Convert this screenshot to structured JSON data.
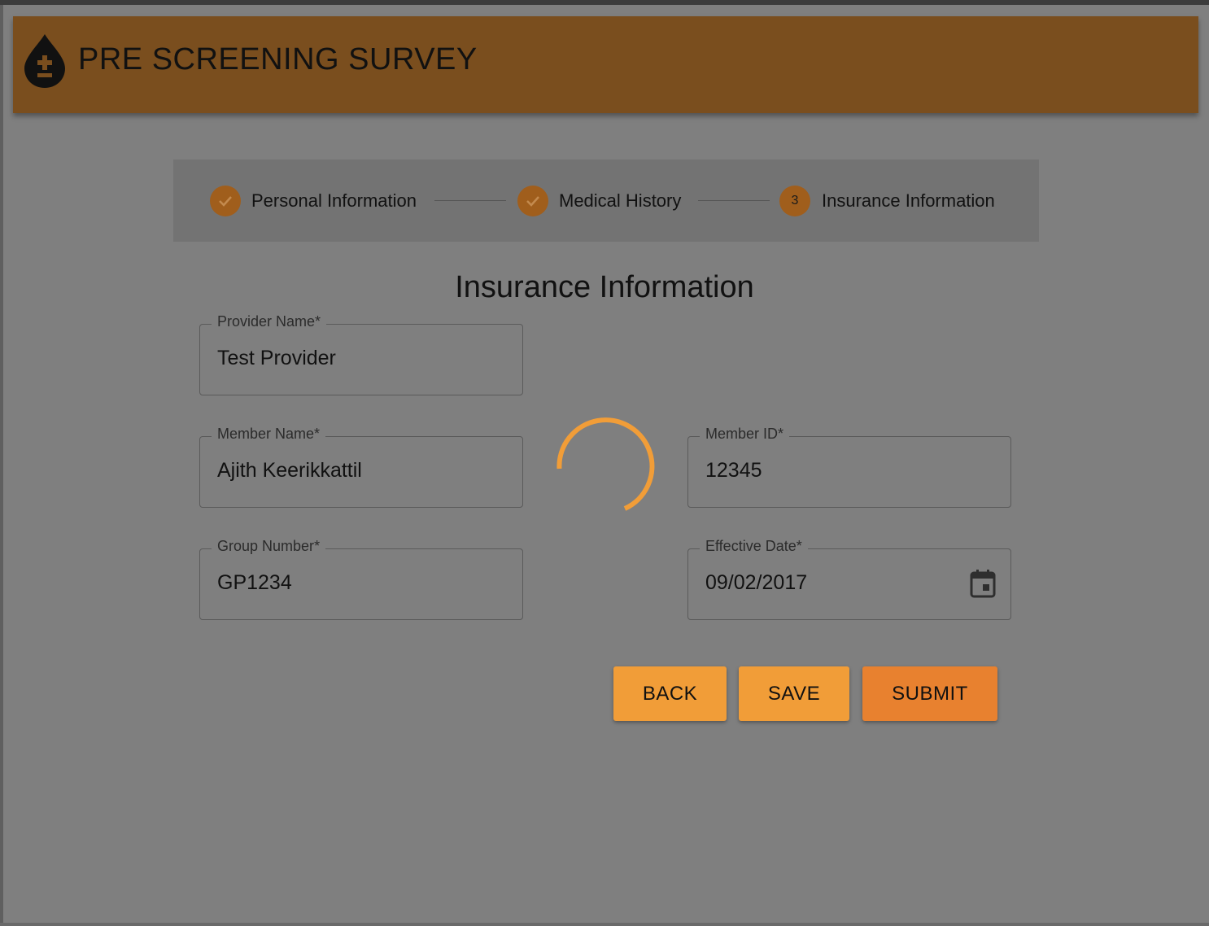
{
  "header": {
    "title": "PRE SCREENING SURVEY",
    "logo_icon": "blood-drop-plus-minus-icon",
    "color": "#7a4e1e"
  },
  "stepper": {
    "steps": [
      {
        "label": "Personal Information",
        "state": "completed",
        "icon": "check-icon"
      },
      {
        "label": "Medical History",
        "state": "completed",
        "icon": "check-icon"
      },
      {
        "label": "Insurance Information",
        "state": "active",
        "number": "3"
      }
    ],
    "accent_color": "#a05e1c"
  },
  "form": {
    "title": "Insurance Information",
    "provider_name": {
      "label": "Provider Name",
      "required_mark": "*",
      "value": "Test Provider"
    },
    "member_name": {
      "label": "Member Name",
      "required_mark": "*",
      "value": "Ajith Keerikkattil"
    },
    "member_id": {
      "label": "Member ID",
      "required_mark": "*",
      "value": "12345"
    },
    "group_number": {
      "label": "Group Number",
      "required_mark": "*",
      "value": "GP1234"
    },
    "effective_date": {
      "label": "Effective Date",
      "required_mark": "*",
      "value": "09/02/2017",
      "icon": "calendar-icon"
    }
  },
  "loading_spinner": {
    "color": "#f19d38"
  },
  "actions": {
    "back_label": "BACK",
    "save_label": "SAVE",
    "submit_label": "SUBMIT",
    "button_color": "#f19d38",
    "submit_color": "#e8812f"
  }
}
